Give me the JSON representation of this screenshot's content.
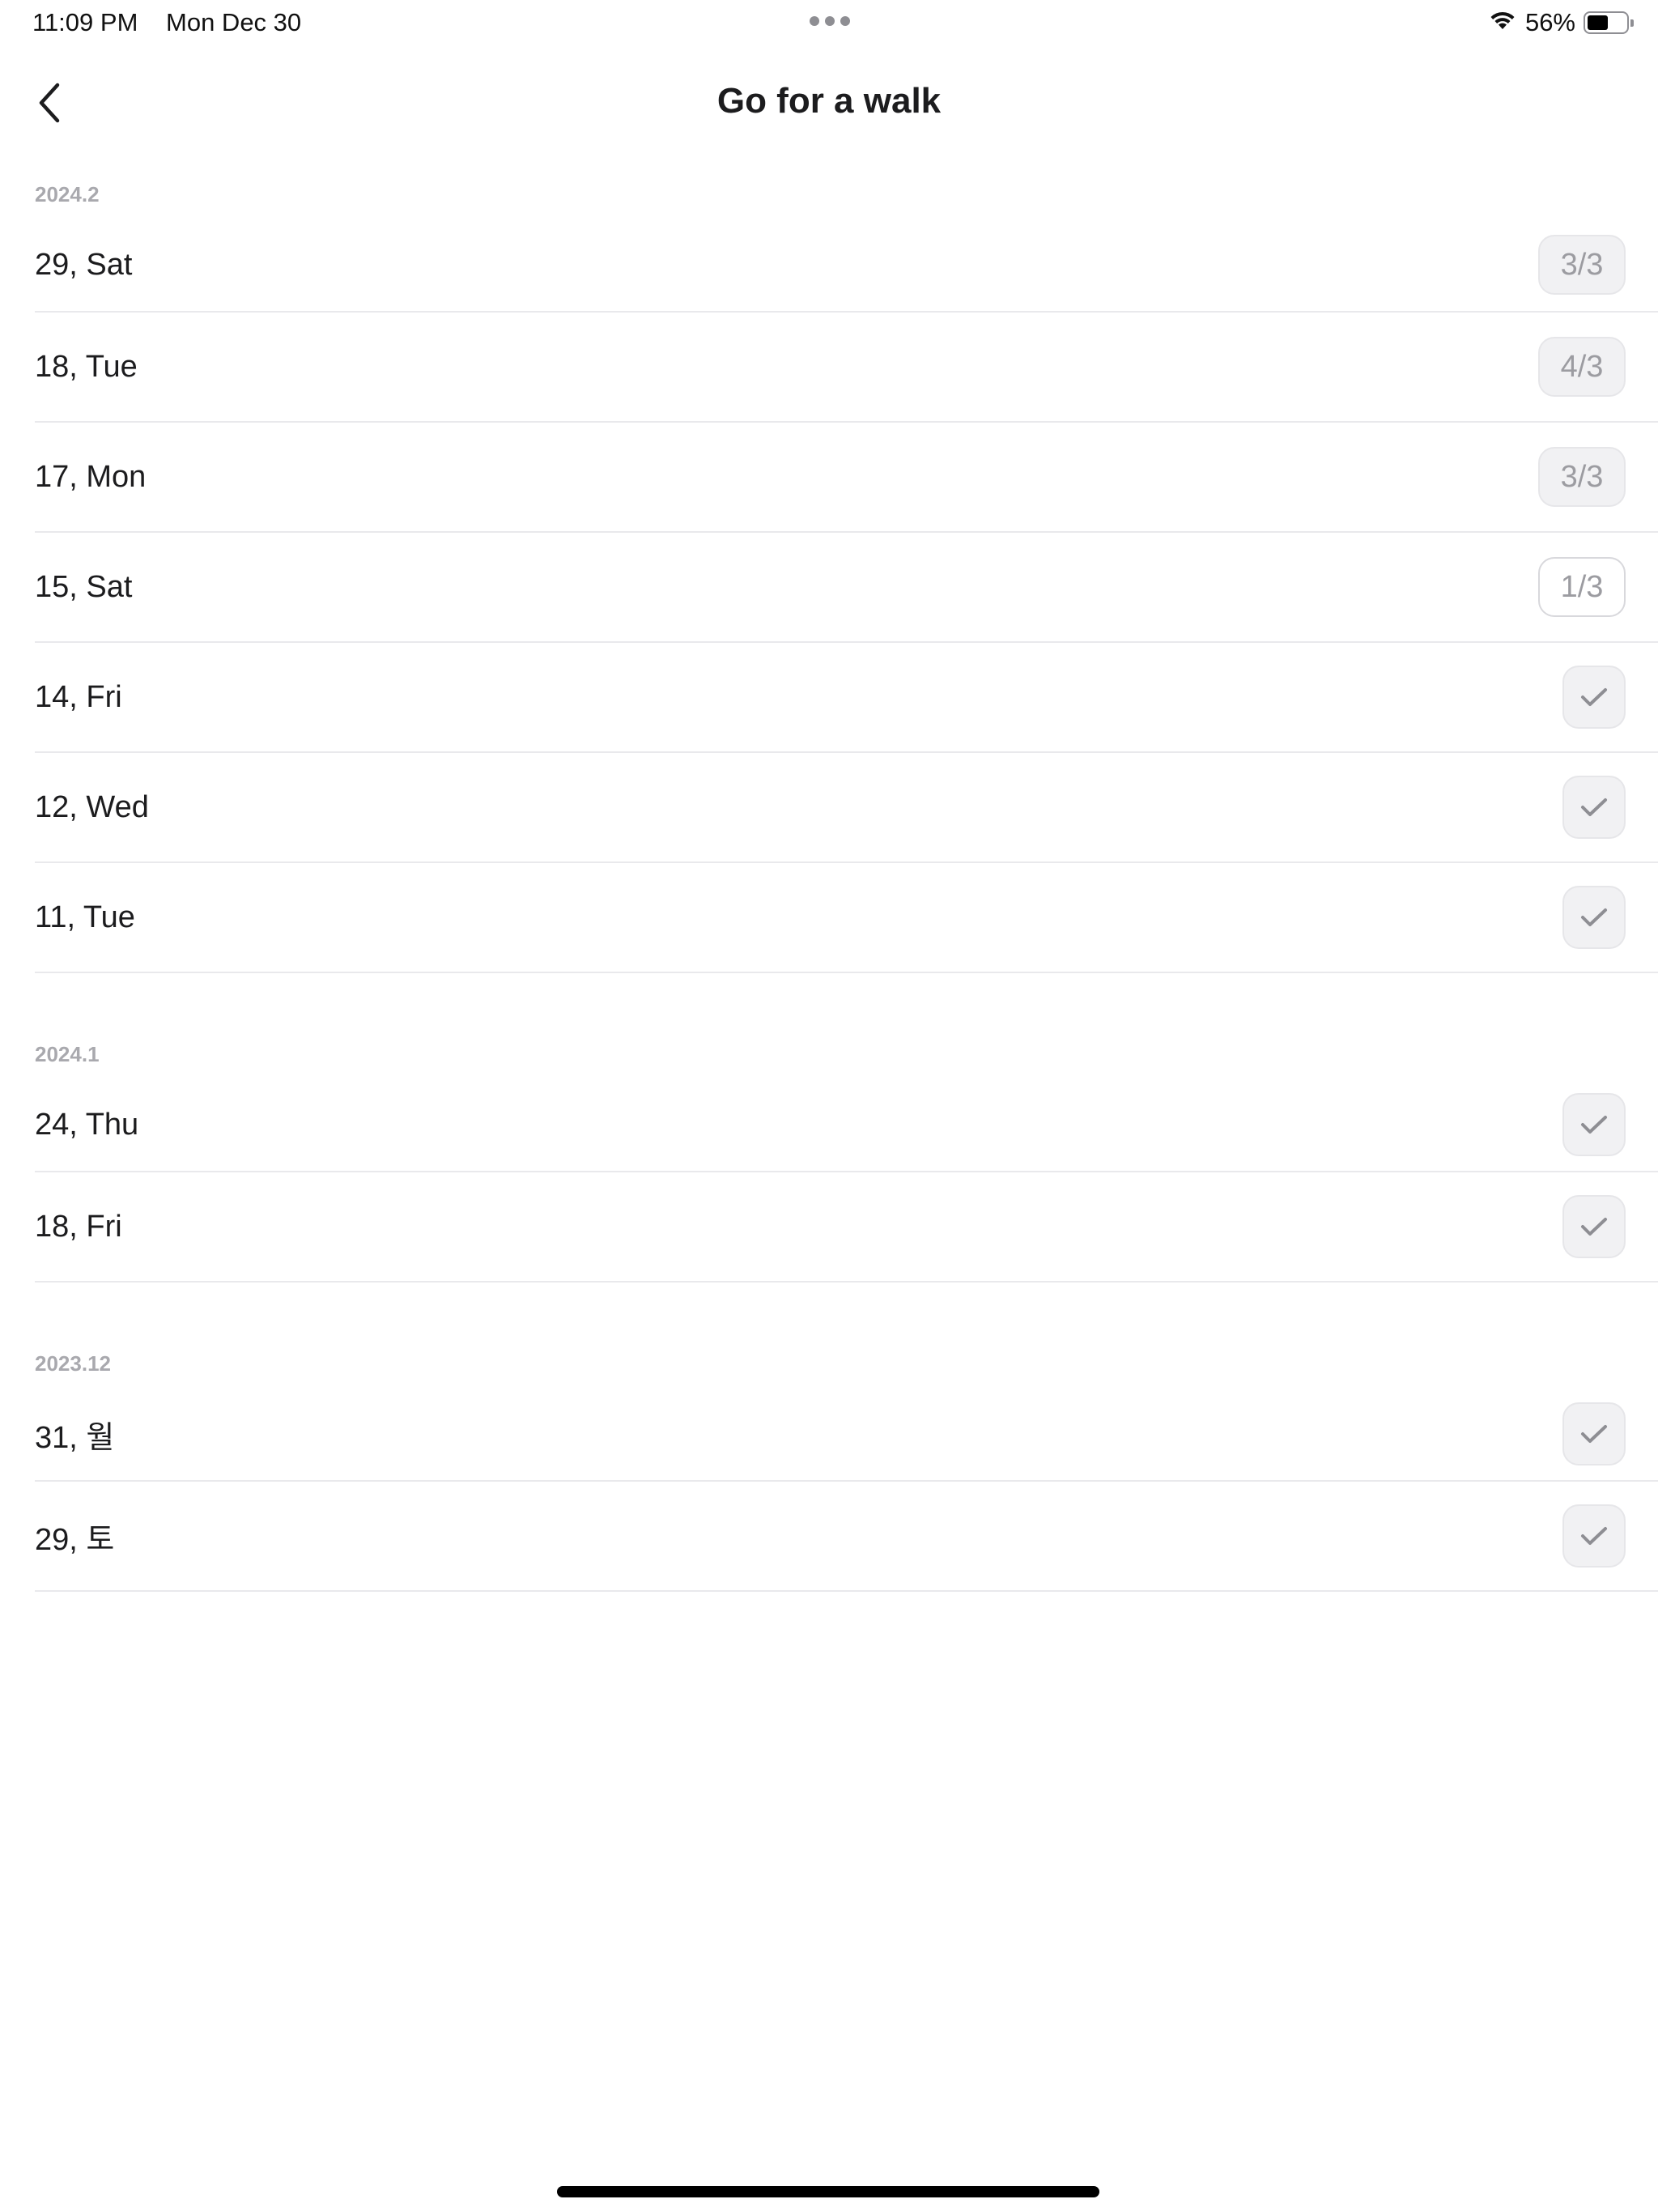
{
  "status_bar": {
    "time": "11:09 PM",
    "date": "Mon Dec 30",
    "battery": "56%",
    "battery_level": 0.56
  },
  "nav": {
    "title": "Go for a walk",
    "back_icon": "chevron-left-icon"
  },
  "sections": [
    {
      "header": "2024.2",
      "rows": [
        {
          "label": "29, Sat",
          "badge": "3/3",
          "badge_style": "filled"
        },
        {
          "label": "18, Tue",
          "badge": "4/3",
          "badge_style": "filled"
        },
        {
          "label": "17, Mon",
          "badge": "3/3",
          "badge_style": "filled"
        },
        {
          "label": "15, Sat",
          "badge": "1/3",
          "badge_style": "outline"
        },
        {
          "label": "14, Fri",
          "badge": null,
          "icon": "checkmark-icon"
        },
        {
          "label": "12, Wed",
          "badge": null,
          "icon": "checkmark-icon"
        },
        {
          "label": "11, Tue",
          "badge": null,
          "icon": "checkmark-icon"
        }
      ]
    },
    {
      "header": "2024.1",
      "rows": [
        {
          "label": "24, Thu",
          "badge": null,
          "icon": "checkmark-icon"
        },
        {
          "label": "18, Fri",
          "badge": null,
          "icon": "checkmark-icon"
        }
      ]
    },
    {
      "header": "2023.12",
      "rows": [
        {
          "label": "31, 월",
          "badge": null,
          "icon": "checkmark-icon"
        },
        {
          "label": "29, 토",
          "badge": null,
          "icon": "checkmark-icon"
        }
      ]
    }
  ],
  "colors": {
    "background": "#ffffff",
    "text": "#1c1c1e",
    "secondary_text": "#a9a9ae",
    "divider": "#e9e9ec",
    "badge_bg": "#f1f1f3"
  }
}
